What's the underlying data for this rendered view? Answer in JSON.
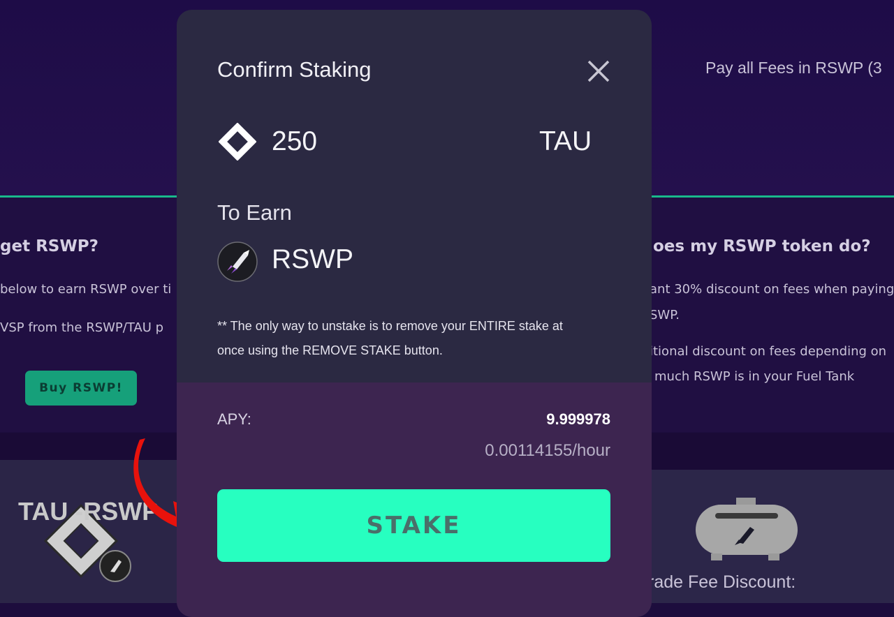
{
  "background": {
    "fees_banner": "Pay all Fees in RSWP (3",
    "left_heading": "get RSWP?",
    "left_lines": [
      "below to earn RSWP over ti",
      "VSP from the RSWP/TAU    p"
    ],
    "buy_button": "Buy RSWP!",
    "right_heading": "oes my RSWP token do?",
    "right_lines": [
      "ant 30% discount on fees when paying",
      "SWP.",
      "itional discount on fees depending on",
      "much RSWP is in your Fuel Tank"
    ],
    "pair_title": "TAU -RSWP",
    "fee_discount": "rade Fee Discount:"
  },
  "modal": {
    "title": "Confirm Staking",
    "close_icon": "close-icon",
    "amount": "250",
    "symbol": "TAU",
    "to_earn_label": "To Earn",
    "earn_token": "RSWP",
    "note": "** The only way to unstake is to remove your ENTIRE stake at once using the REMOVE STAKE button.",
    "apy_label": "APY:",
    "apy_value": "9.999978",
    "apy_rate": "0.00114155/hour",
    "stake_button": "STAKE"
  },
  "annotation": {
    "arrow_color": "#e8120c",
    "pointer_target": "stake-button"
  },
  "colors": {
    "accent": "#27ffc0",
    "modal_bg": "#2b2942",
    "panel_bg": "#3d2550",
    "page_bg": "#1d0d3d"
  }
}
